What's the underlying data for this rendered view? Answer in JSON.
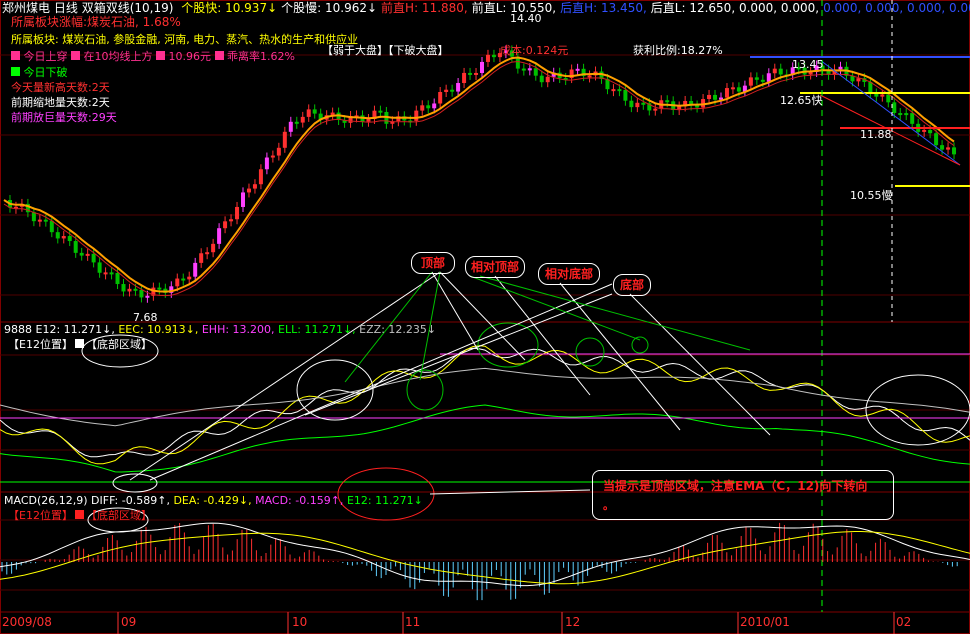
{
  "header": {
    "stock": "郑州煤电",
    "period": "日线",
    "indicator": "双箱双线(10,19)",
    "items": [
      {
        "label": "个股快: 10.937↓",
        "color": "#ffff00"
      },
      {
        "label": "个股慢: 10.962↓",
        "color": "#ffffff"
      },
      {
        "label": "前直H: 11.880,",
        "color": "#ff3030"
      },
      {
        "label": "前直L: 10.550,",
        "color": "#ffffff"
      },
      {
        "label": "后直H: 13.450,",
        "color": "#3050ff"
      },
      {
        "label": "后直L: 12.650, 0.000, 0.000,",
        "color": "#ffffff"
      },
      {
        "label": "0.000, 0.000, 0.000, 0.000",
        "color": "#3050ff"
      }
    ]
  },
  "info": {
    "sector_change": "所属板块涨幅:煤炭石油, 1.68%",
    "sectors": "所属板块: 煤炭石油, 参股金融, 河南, 电力、蒸汽、热水的生产和供应业",
    "today_up": "今日上穿",
    "above_ma10": "在10均线上方",
    "price": "10.96元",
    "deviation": "乖离率1.62%",
    "today_down": "今日下破",
    "new_high_days": "今天量新高天数:2天",
    "shrink_days": "前期缩地量天数:2天",
    "big_vol_days": "前期放巨量天数:29天",
    "market_buttons": "【弱于大盘】【下破大盘】",
    "cost": "成本:0.124元",
    "profit_ratio": "获利比例:18.27%",
    "price_1440": "14.40",
    "price_1345": "13.45",
    "price_1265": "12.65快",
    "price_1188": "11.88",
    "price_1055": "10.55慢",
    "price_768": "7.68"
  },
  "annotations": {
    "top": "顶部",
    "relative_top": "相对顶部",
    "relative_bottom": "相对底部",
    "bottom": "底部",
    "note": "当提示是顶部区域，注意EMA（C，12)向下转向",
    "note_dot": "。"
  },
  "panel2": {
    "title": "9888",
    "e12": "E12: 11.271↓,",
    "eec": "EEC: 10.913↓,",
    "ehh": "EHH: 13.200,",
    "ell": "ELL: 11.271↓,",
    "ezz": "EZZ: 12.235↓",
    "e12_pos": "【E12位置】",
    "bottom_zone": "【底部区域】"
  },
  "panel3": {
    "title": "MACD(26,12,9)",
    "diff": "DIFF: -0.589↑,",
    "dea": "DEA: -0.429↓,",
    "macd": "MACD: -0.159↑,",
    "e12": "E12: 11.271↓",
    "e12_pos": "【E12位置】",
    "bottom_zone": "【底部区域】"
  },
  "xaxis": {
    "labels": [
      "2009/08",
      "09",
      "10",
      "11",
      "12",
      "2010/01",
      "02"
    ]
  },
  "colors": {
    "up": "#ff3030",
    "down": "#00c000",
    "ma": "#ffa000",
    "grid": "#800000"
  }
}
